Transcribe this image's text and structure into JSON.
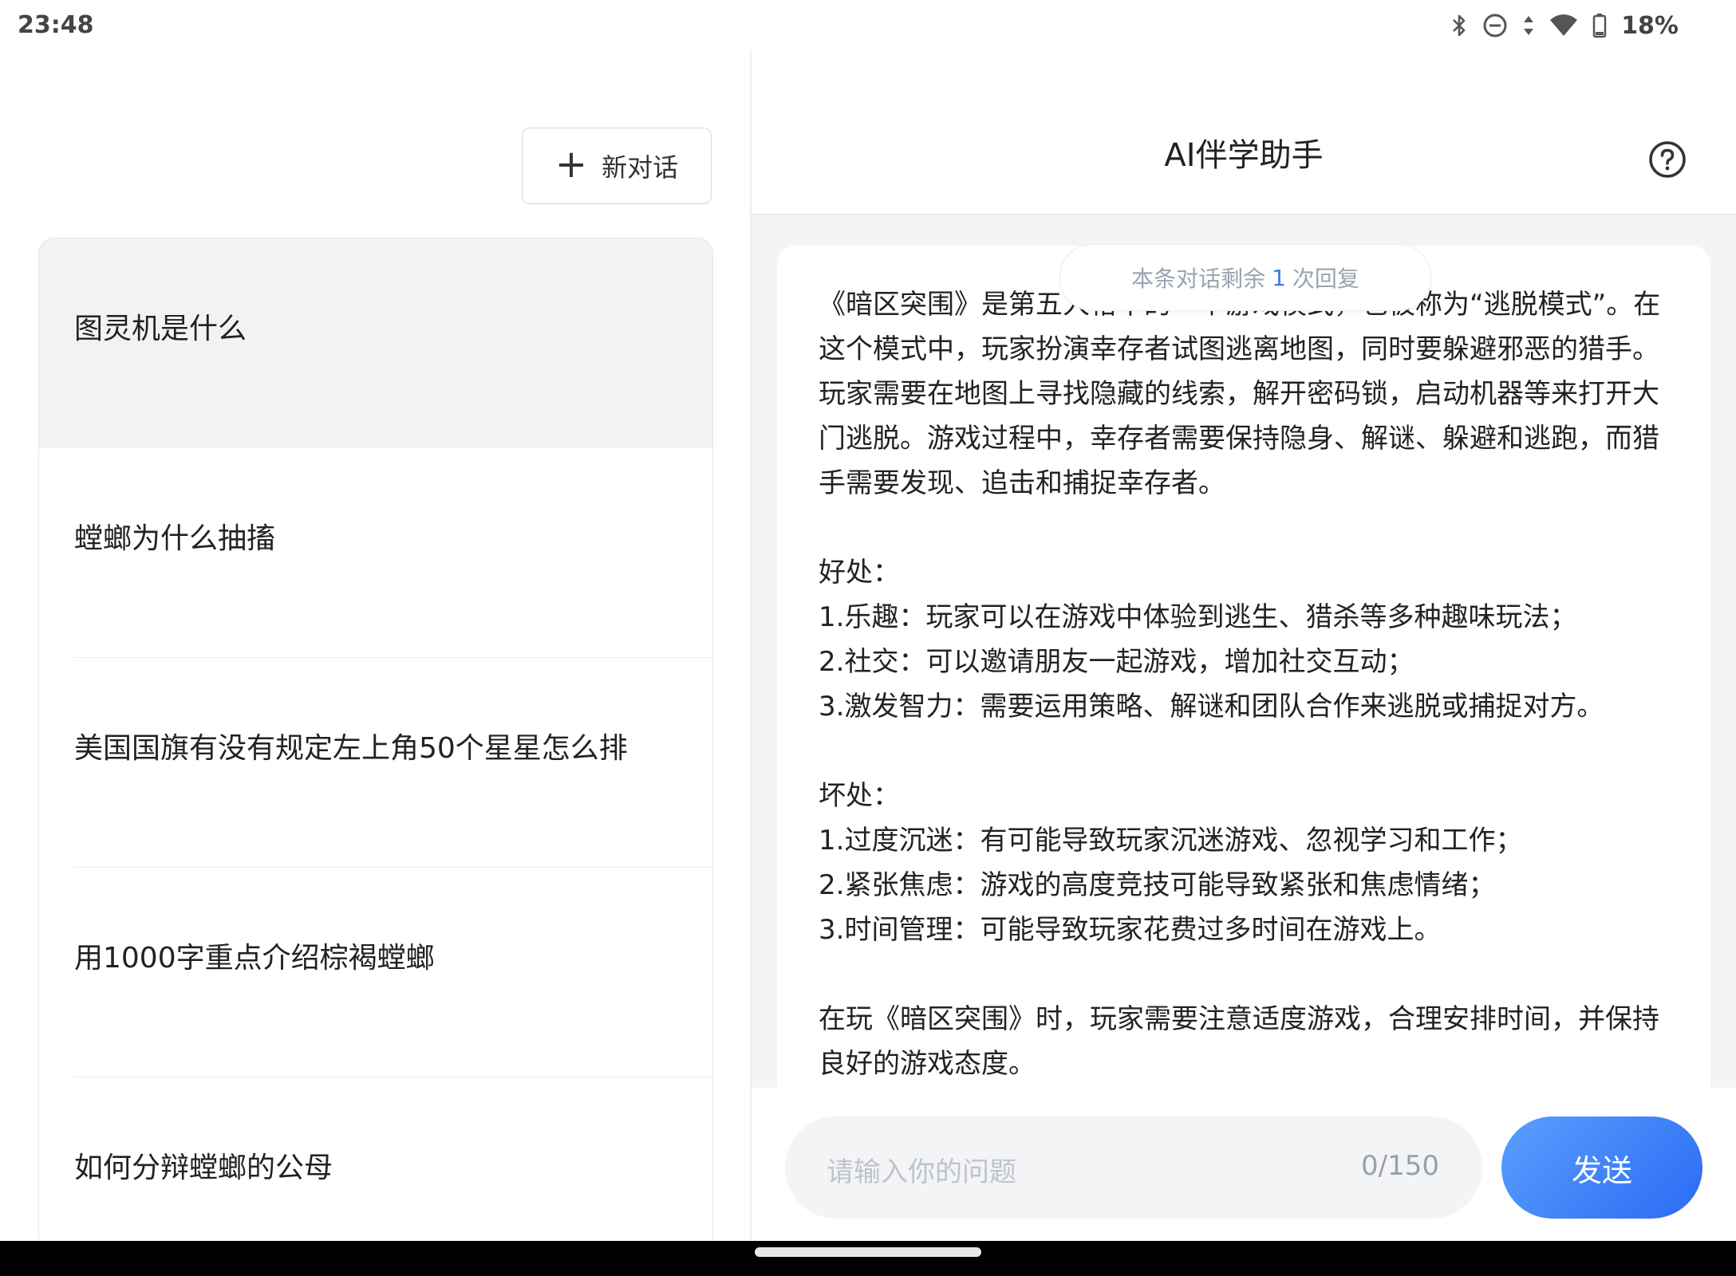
{
  "status_bar": {
    "time": "23:48",
    "icons": [
      "bluetooth-icon",
      "dnd-icon",
      "data-arrows-icon",
      "wifi-icon",
      "battery-icon"
    ],
    "battery": "18%"
  },
  "sidebar": {
    "new_chat_label": "新对话",
    "history": [
      {
        "title": "图灵机是什么",
        "active": true
      },
      {
        "title": "螳螂为什么抽搐",
        "active": false
      },
      {
        "title": "美国国旗有没有规定左上角50个星星怎么排",
        "active": false
      },
      {
        "title": "用1000字重点介绍棕褐螳螂",
        "active": false
      },
      {
        "title": "如何分辩螳螂的公母",
        "active": false
      }
    ]
  },
  "chat": {
    "title": "AI伴学助手",
    "quota": {
      "prefix": "本条对话剩余",
      "count": "1",
      "suffix": "次回复"
    },
    "message": "《暗区突围》是第五人格中的一个游戏模式，也被称为“逃脱模式”。在这个模式中，玩家扮演幸存者试图逃离地图，同时要躲避邪恶的猎手。玩家需要在地图上寻找隐藏的线索，解开密码锁，启动机器等来打开大门逃脱。游戏过程中，幸存者需要保持隐身、解谜、躲避和逃跑，而猎手需要发现、追击和捕捉幸存者。\n\n好处：\n1.乐趣：玩家可以在游戏中体验到逃生、猎杀等多种趣味玩法；\n2.社交：可以邀请朋友一起游戏，增加社交互动；\n3.激发智力：需要运用策略、解谜和团队合作来逃脱或捕捉对方。\n\n坏处：\n1.过度沉迷：有可能导致玩家沉迷游戏、忽视学习和工作；\n2.紧张焦虑：游戏的高度竞技可能导致紧张和焦虑情绪；\n3.时间管理：可能导致玩家花费过多时间在游戏上。\n\n在玩《暗区突围》时，玩家需要注意适度游戏，合理安排时间，并保持良好的游戏态度。",
    "input": {
      "placeholder": "请输入你的问题",
      "counter": "0/150"
    },
    "send_label": "发送"
  },
  "colors": {
    "accent": "#3a79f0",
    "send_gradient_start": "#5aa0ff",
    "send_gradient_end": "#2b6af3"
  }
}
